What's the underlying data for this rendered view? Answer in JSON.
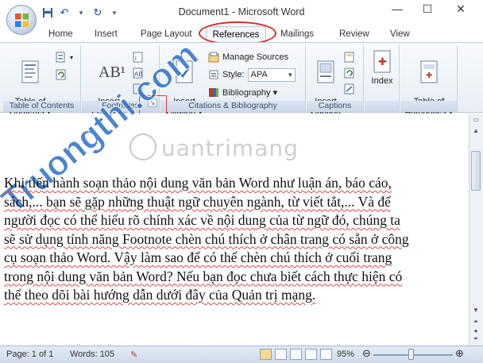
{
  "window": {
    "title": "Document1 - Microsoft Word",
    "minimize": "—",
    "maximize": "☐",
    "close": "✕"
  },
  "qat": {
    "save_icon": "save-icon",
    "undo_icon": "undo-icon",
    "redo_icon": "redo-icon",
    "customize_icon": "dropdown-icon"
  },
  "tabs": [
    "Home",
    "Insert",
    "Page Layout",
    "References",
    "Mailings",
    "Review",
    "View"
  ],
  "active_tab": "References",
  "ribbon": {
    "toc": {
      "table_of_contents": "Table of\nContents ▾",
      "group_label": "Table of Contents"
    },
    "footnotes": {
      "insert_footnote": "Insert\nFootnote",
      "big_icon_text": "AB¹",
      "group_label": "Footnotes"
    },
    "citations": {
      "insert_citation": "Insert\nCitation ▾",
      "manage_sources": "Manage Sources",
      "style_label": "Style:",
      "style_value": "APA",
      "bibliography": "Bibliography ▾",
      "group_label": "Citations & Bibliography"
    },
    "captions": {
      "insert_caption": "Insert\nCaption",
      "group_label": "Captions"
    },
    "index": {
      "index": "Index",
      "big_icon_text": "✚"
    },
    "toa": {
      "table_of_authorities": "Table of\nAuthorities ▾"
    }
  },
  "document": {
    "watermark": "uantrimang",
    "diagonal_watermark": "Truongthi.com",
    "lines": [
      "Khi tiến hành soạn thảo nội dung văn bản Word như luận án, báo cáo,",
      "sách,... bạn sẽ gặp những thuật ngữ chuyên ngành, từ viết tắt,... Và để",
      "người đọc có thể hiểu rõ chính xác về nội dung của từ ngữ đó, chúng ta",
      "sẽ sử dụng tính năng Footnote chèn chú thích ở chân trang có sẵn ở công",
      "cụ soạn thảo Word. Vậy làm sao để có thể chèn chú thích ở cuối trang",
      "trong nội dung văn bản Word? Nếu bạn đọc chưa biết cách thực hiện có",
      "thể theo dõi bài hướng dẫn dưới đây của Quản trị mạng."
    ]
  },
  "status": {
    "page": "Page: 1 of 1",
    "words": "Words: 105",
    "zoom": "95%",
    "zoom_level": 0.95
  },
  "colors": {
    "highlight": "#d52b2b",
    "ribbon_accent": "#1e4e8c"
  }
}
